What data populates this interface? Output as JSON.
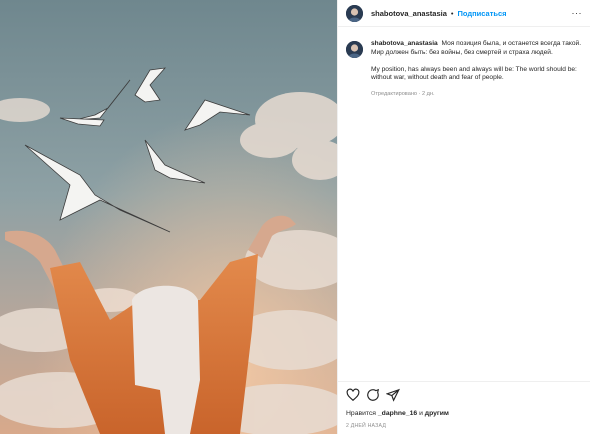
{
  "post": {
    "username": "shabotova_anastasia",
    "separator": "•",
    "follow_label": "Подписаться",
    "more_label": "···",
    "caption": {
      "line1": "Моя позиция была, и останется всегда такой.",
      "line2": "Мир должен быть: без войны, без смертей и страха людей.",
      "line3": "My position, has always been and always will be: The world should be: without war, without death and fear of people.",
      "edited": "Отредактировано · 2 дн."
    },
    "likes": {
      "prefix": "Нравится ",
      "user": "_daphne_16",
      "suffix": " и ",
      "others": "другим"
    },
    "time_ago": "2 ДНЕЙ НАЗАД"
  },
  "icons": {
    "like": "heart-icon",
    "comment": "comment-icon",
    "share": "share-icon",
    "more": "more-icon"
  },
  "colors": {
    "follow": "#0095f6",
    "text": "#262626",
    "muted": "#8e8e8e",
    "sky": "#7d949b",
    "jacket": "#d9733a"
  }
}
